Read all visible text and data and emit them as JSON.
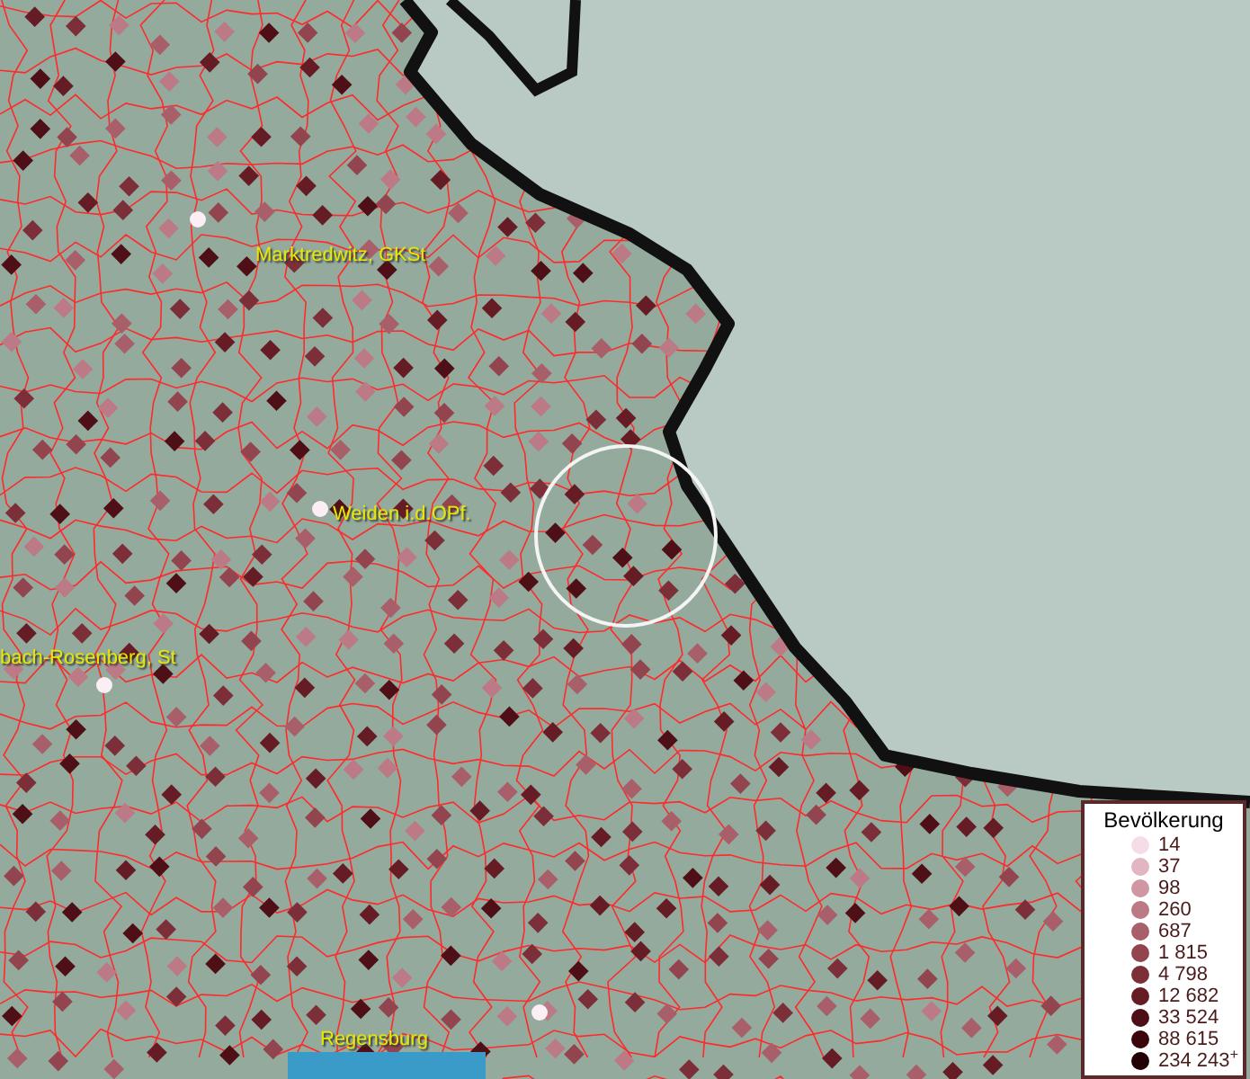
{
  "map": {
    "places": [
      {
        "name": "Marktredwitz, GKSt"
      },
      {
        "name": "Weiden i.d.OPf."
      },
      {
        "name": "bach-Rosenberg, St"
      },
      {
        "name": "Regensburg"
      }
    ]
  },
  "legend": {
    "title": "Bevölkerung",
    "items": [
      {
        "label": "14",
        "color": "#f5dce8"
      },
      {
        "label": "37",
        "color": "#e3b5c3"
      },
      {
        "label": "98",
        "color": "#cf97a4"
      },
      {
        "label": "260",
        "color": "#bb7a85"
      },
      {
        "label": "687",
        "color": "#a95f69"
      },
      {
        "label": "1 815",
        "color": "#93454f"
      },
      {
        "label": "4 798",
        "color": "#7c2f38"
      },
      {
        "label": "12 682",
        "color": "#661c25"
      },
      {
        "label": "33 524",
        "color": "#4f0f17"
      },
      {
        "label": "88 615",
        "color": "#3a060c"
      },
      {
        "label": "234 243$^{+}$",
        "color": "#220205"
      }
    ]
  }
}
